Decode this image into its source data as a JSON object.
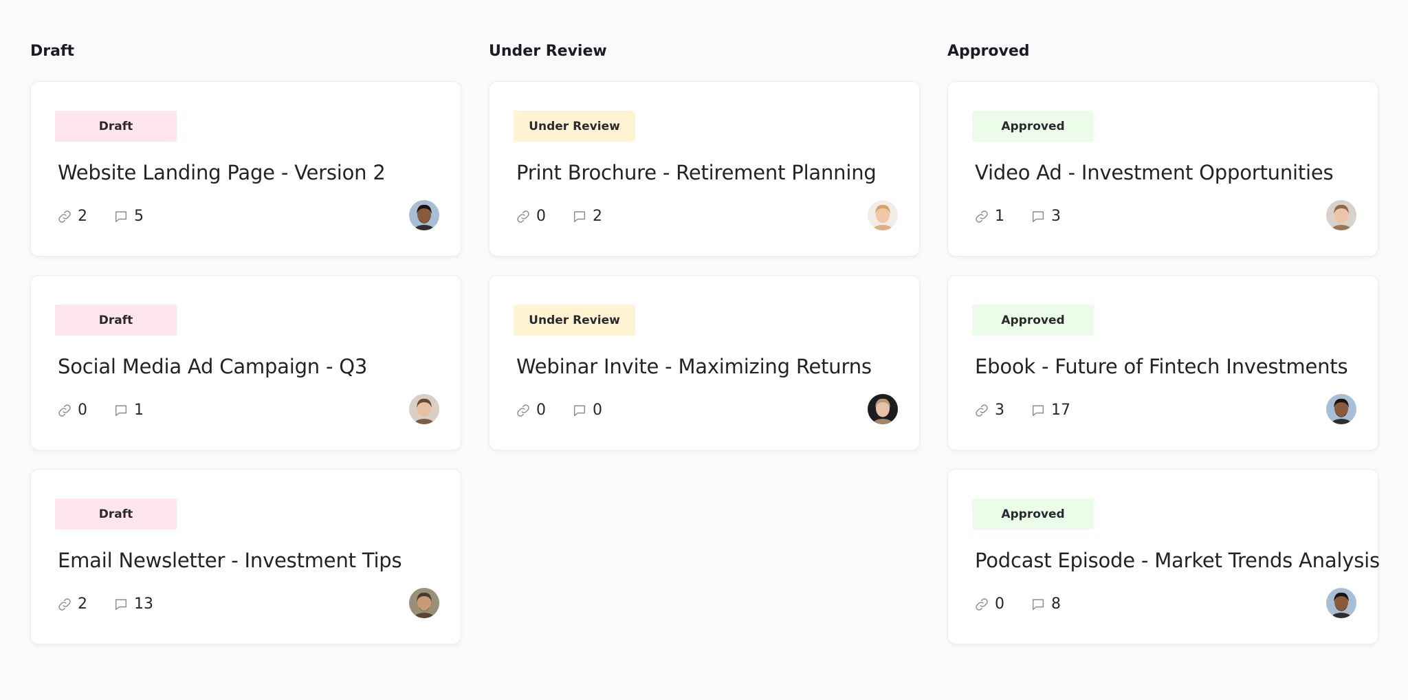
{
  "columns": [
    {
      "title": "Draft",
      "badge_color": "#ffe5ec",
      "cards": [
        {
          "badge": "Draft",
          "title": "Website Landing Page - Version 2",
          "links": "2",
          "comments": "5",
          "avatar": {
            "bg": "#a8bed4",
            "skin": "#8a5a3c",
            "hair": "#1c1410",
            "beard": true
          }
        },
        {
          "badge": "Draft",
          "title": "Social Media Ad Campaign - Q3",
          "links": "0",
          "comments": "1",
          "avatar": {
            "bg": "#d8cfc6",
            "skin": "#e7bfa2",
            "hair": "#6b4a34",
            "beard": false
          }
        },
        {
          "badge": "Draft",
          "title": "Email Newsletter - Investment Tips",
          "links": "2",
          "comments": "13",
          "avatar": {
            "bg": "#9a8f78",
            "skin": "#c99a75",
            "hair": "#4b3a2a",
            "beard": true
          }
        }
      ]
    },
    {
      "title": "Under Review",
      "badge_color": "#fff4d1",
      "cards": [
        {
          "badge": "Under Review",
          "title": "Print Brochure - Retirement Planning",
          "links": "0",
          "comments": "2",
          "avatar": {
            "bg": "#f2ede7",
            "skin": "#f0c9a8",
            "hair": "#d7a36c",
            "beard": false
          }
        },
        {
          "badge": "Under Review",
          "title": "Webinar Invite - Maximizing Returns",
          "links": "0",
          "comments": "0",
          "avatar": {
            "bg": "#1d1d1f",
            "skin": "#e6c2a6",
            "hair": "#b79a78",
            "beard": false
          }
        }
      ]
    },
    {
      "title": "Approved",
      "badge_color": "#ebfde9",
      "cards": [
        {
          "badge": "Approved",
          "title": "Video Ad - Investment Opportunities",
          "links": "1",
          "comments": "3",
          "avatar": {
            "bg": "#d9d2cb",
            "skin": "#ecc4a8",
            "hair": "#8b6647",
            "beard": false
          }
        },
        {
          "badge": "Approved",
          "title": "Ebook - Future of Fintech Investments",
          "links": "3",
          "comments": "17",
          "avatar": {
            "bg": "#a8bed4",
            "skin": "#8a5a3c",
            "hair": "#1c1410",
            "beard": true
          }
        },
        {
          "badge": "Approved",
          "title": "Podcast Episode - Market Trends Analysis",
          "links": "0",
          "comments": "8",
          "avatar": {
            "bg": "#a8bed4",
            "skin": "#8a5a3c",
            "hair": "#1c1410",
            "beard": true
          }
        }
      ]
    }
  ],
  "icons": {
    "links": "link-icon",
    "comments": "comment-icon"
  }
}
